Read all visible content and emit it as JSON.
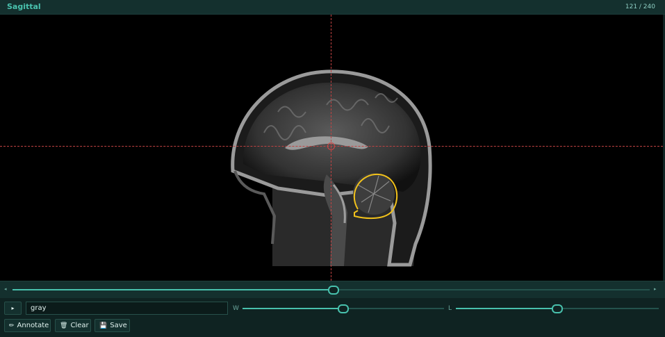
{
  "header": {
    "title": "Sagittal",
    "slice_counter": "121 / 240"
  },
  "viewer": {
    "crosshair_color": "#c24242",
    "annotation_color": "#f2c21b"
  },
  "slice_slider": {
    "value": 121,
    "max": 240,
    "left_arrow": "◂",
    "right_arrow": "▸"
  },
  "controls": {
    "play_icon": "▸",
    "colormap_value": "gray",
    "window_label": "W",
    "window_fraction": 0.5,
    "level_label": "L",
    "level_fraction": 0.5,
    "annotate_label": "Annotate",
    "annotate_icon": "pencil-icon",
    "clear_label": "Clear",
    "clear_icon": "trash-icon",
    "save_label": "Save",
    "save_icon": "floppy-icon"
  },
  "colors": {
    "accent": "#48c1ad",
    "background": "#0f2322"
  }
}
